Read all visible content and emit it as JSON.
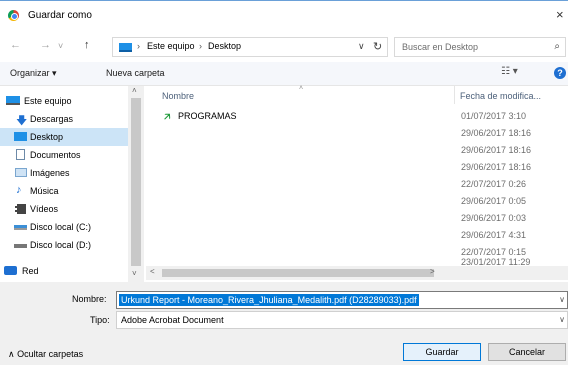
{
  "window": {
    "title": "Guardar como",
    "close_glyph": "×"
  },
  "nav": {
    "back_glyph": "←",
    "forward_glyph": "→",
    "up_glyph": "↑",
    "path": [
      "Este equipo",
      "Desktop"
    ],
    "path_separator": "›",
    "dropdown_glyph": "∨",
    "refresh_glyph": "↻",
    "search_placeholder": "Buscar en Desktop",
    "search_glyph": "⌕"
  },
  "toolbar": {
    "organize_label": "Organizar ▾",
    "new_folder_label": "Nueva carpeta",
    "view_glyph": "☷ ▾",
    "help_glyph": "?"
  },
  "sidebar": {
    "items": [
      {
        "label": "Este equipo",
        "icon": "computer-icon",
        "color": "#1e90e6",
        "selected": false
      },
      {
        "label": "Descargas",
        "icon": "download-icon",
        "color": "#1e6fd1",
        "selected": false
      },
      {
        "label": "Desktop",
        "icon": "desktop-folder-icon",
        "color": "#1e90e6",
        "selected": true
      },
      {
        "label": "Documentos",
        "icon": "documents-icon",
        "color": "#6d8aa8",
        "selected": false
      },
      {
        "label": "Imágenes",
        "icon": "pictures-icon",
        "color": "#7aa6cf",
        "selected": false
      },
      {
        "label": "Música",
        "icon": "music-icon",
        "color": "#1e6fd1",
        "selected": false
      },
      {
        "label": "Vídeos",
        "icon": "videos-icon",
        "color": "#444444",
        "selected": false
      },
      {
        "label": "Disco local (C:)",
        "icon": "windows-drive-icon",
        "color": "#3c8fd6",
        "selected": false
      },
      {
        "label": "Disco local (D:)",
        "icon": "drive-icon",
        "color": "#777777",
        "selected": false
      },
      {
        "label": "Red",
        "icon": "network-icon",
        "color": "#1e6fd1",
        "selected": false
      }
    ],
    "scroll_up_glyph": "˄",
    "scroll_down_glyph": "˅"
  },
  "file_list": {
    "columns": [
      "Nombre",
      "Fecha de modifica..."
    ],
    "sort_glyph": "˄",
    "rows": [
      {
        "name": "PROGRAMAS",
        "date": "01/07/2017 3:10",
        "icon": "green-arrow-shortcut-icon"
      },
      {
        "name": "",
        "date": "29/06/2017 18:16"
      },
      {
        "name": "",
        "date": "29/06/2017 18:16"
      },
      {
        "name": "",
        "date": "29/06/2017 18:16"
      },
      {
        "name": "",
        "date": "22/07/2017 0:26"
      },
      {
        "name": "",
        "date": "29/06/2017 0:05"
      },
      {
        "name": "",
        "date": "29/06/2017 0:03"
      },
      {
        "name": "",
        "date": "29/06/2017 4:31"
      },
      {
        "name": "",
        "date": "22/07/2017 0:15"
      },
      {
        "name": "",
        "date": "23/01/2017 11:29"
      }
    ],
    "scroll_left_glyph": "<",
    "scroll_right_glyph": ">"
  },
  "footer": {
    "name_label": "Nombre:",
    "name_value": "Urkund Report - Moreano_Rivera_Jhuliana_Medalith.pdf (D28289033).pdf",
    "type_label": "Tipo:",
    "type_value": "Adobe Acrobat Document",
    "dropdown_glyph": "∨",
    "hide_folders_label": "∧  Ocultar carpetas",
    "save_label": "Guardar",
    "cancel_label": "Cancelar"
  },
  "colors": {
    "accent": "#0078d7",
    "selection": "#cce4f7",
    "dialog_bg": "#f0f0f0"
  }
}
